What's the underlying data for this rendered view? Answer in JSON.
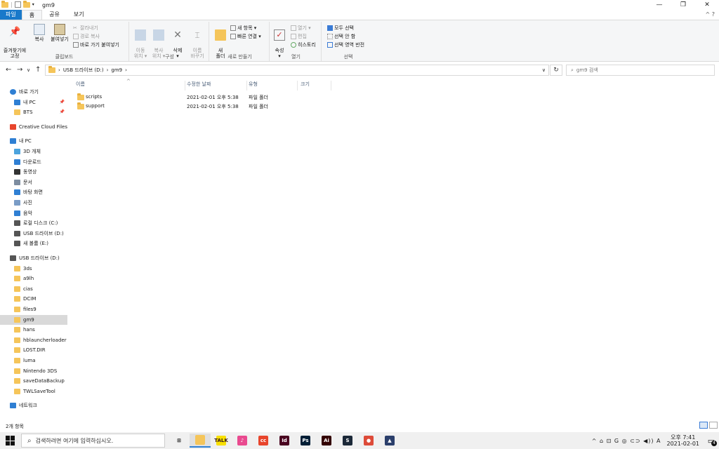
{
  "window": {
    "title": "gm9",
    "controls": {
      "minimize": "—",
      "maximize": "❐",
      "close": "✕"
    }
  },
  "ribbon_tabs": [
    "파일",
    "홈",
    "공유",
    "보기"
  ],
  "ribbon_help": "^ ?",
  "ribbon": {
    "clipboard": {
      "name": "클립보드",
      "pin": "즐겨찾기에\n고정",
      "copy": "복사",
      "paste": "붙여넣기",
      "cut": "잘라내기",
      "copy_path": "경로 복사",
      "paste_shortcut": "바로 가기 붙여넣기"
    },
    "organize": {
      "name": "구성",
      "move_to": "이동\n위치 ▾",
      "copy_to": "복사\n위치 ▾",
      "delete": "삭제\n▾",
      "rename": "이름\n바꾸기"
    },
    "new": {
      "name": "새로 만들기",
      "new_folder": "새\n폴더",
      "new_item": "새 항목 ▾",
      "easy_access": "빠른 연결 ▾"
    },
    "open": {
      "name": "열기",
      "properties": "속성\n▾",
      "open": "열기 ▾",
      "edit": "편집",
      "history": "히스토리"
    },
    "select": {
      "name": "선택",
      "select_all": "모두 선택",
      "select_none": "선택 안 함",
      "invert": "선택 영역 반전"
    }
  },
  "address": {
    "crumbs": [
      "USB 드라이브 (D:)",
      "gm9"
    ],
    "search_placeholder": "gm9 검색"
  },
  "sidebar": {
    "items": [
      {
        "label": "바로 가기",
        "icon": "star-icon",
        "indent": 0,
        "pinned": false
      },
      {
        "label": "내 PC",
        "icon": "pc-icon",
        "indent": 1,
        "pinned": true
      },
      {
        "label": "BTS",
        "icon": "folder-icon",
        "indent": 1,
        "pinned": true
      },
      {
        "label": "Creative Cloud Files",
        "icon": "creative-cloud-icon",
        "indent": 0,
        "pinned": false
      },
      {
        "label": "내 PC",
        "icon": "pc-icon",
        "indent": 0,
        "pinned": false
      },
      {
        "label": "3D 개체",
        "icon": "cube-icon",
        "indent": 1,
        "pinned": false
      },
      {
        "label": "다운로드",
        "icon": "download-icon",
        "indent": 1,
        "pinned": false
      },
      {
        "label": "동영상",
        "icon": "video-icon",
        "indent": 1,
        "pinned": false
      },
      {
        "label": "문서",
        "icon": "document-icon",
        "indent": 1,
        "pinned": false
      },
      {
        "label": "바탕 화면",
        "icon": "desktop-icon",
        "indent": 1,
        "pinned": false
      },
      {
        "label": "사진",
        "icon": "pictures-icon",
        "indent": 1,
        "pinned": false
      },
      {
        "label": "음악",
        "icon": "music-icon",
        "indent": 1,
        "pinned": false
      },
      {
        "label": "로컬 디스크 (C:)",
        "icon": "disk-icon",
        "indent": 1,
        "pinned": false
      },
      {
        "label": "USB 드라이브 (D:)",
        "icon": "usb-drive-icon",
        "indent": 1,
        "pinned": false
      },
      {
        "label": "새 볼륨 (E:)",
        "icon": "disk-icon",
        "indent": 1,
        "pinned": false
      },
      {
        "label": "USB 드라이브 (D:)",
        "icon": "usb-drive-icon",
        "indent": 0,
        "pinned": false
      },
      {
        "label": "3ds",
        "icon": "folder-icon",
        "indent": 1,
        "pinned": false
      },
      {
        "label": "a9lh",
        "icon": "folder-icon",
        "indent": 1,
        "pinned": false
      },
      {
        "label": "cias",
        "icon": "folder-icon",
        "indent": 1,
        "pinned": false
      },
      {
        "label": "DCIM",
        "icon": "folder-icon",
        "indent": 1,
        "pinned": false
      },
      {
        "label": "files9",
        "icon": "folder-icon",
        "indent": 1,
        "pinned": false
      },
      {
        "label": "gm9",
        "icon": "folder-icon",
        "indent": 1,
        "pinned": false,
        "selected": true
      },
      {
        "label": "hans",
        "icon": "folder-icon",
        "indent": 1,
        "pinned": false
      },
      {
        "label": "hblauncherloader",
        "icon": "folder-icon",
        "indent": 1,
        "pinned": false
      },
      {
        "label": "LOST.DIR",
        "icon": "folder-icon",
        "indent": 1,
        "pinned": false
      },
      {
        "label": "luma",
        "icon": "folder-icon",
        "indent": 1,
        "pinned": false
      },
      {
        "label": "Nintendo 3DS",
        "icon": "folder-icon",
        "indent": 1,
        "pinned": false
      },
      {
        "label": "saveDataBackup",
        "icon": "folder-icon",
        "indent": 1,
        "pinned": false
      },
      {
        "label": "TWLSaveTool",
        "icon": "folder-icon",
        "indent": 1,
        "pinned": false
      },
      {
        "label": "네트워크",
        "icon": "network-icon",
        "indent": 0,
        "pinned": false
      }
    ]
  },
  "columns": [
    "이름",
    "수정한 날짜",
    "유형",
    "크기"
  ],
  "files": [
    {
      "name": "scripts",
      "modified": "2021-02-01 오후 5:38",
      "type": "파일 폴더",
      "size": ""
    },
    {
      "name": "support",
      "modified": "2021-02-01 오후 5:38",
      "type": "파일 폴더",
      "size": ""
    }
  ],
  "status": {
    "count": "2개 항목"
  },
  "taskbar": {
    "search_placeholder": "검색하려면 여기에 입력하십시오.",
    "apps": [
      {
        "name": "task-view",
        "glyph": "⊞",
        "color": "#f0f0f0"
      },
      {
        "name": "file-explorer",
        "glyph": "",
        "color": "#f5c55a",
        "active": true
      },
      {
        "name": "kakaotalk",
        "glyph": "TALK",
        "color": "#f9e000"
      },
      {
        "name": "itunes",
        "glyph": "♪",
        "color": "#e94a8f"
      },
      {
        "name": "creative-cloud",
        "glyph": "cc",
        "color": "#e8452c"
      },
      {
        "name": "indesign",
        "glyph": "Id",
        "color": "#49021f"
      },
      {
        "name": "photoshop",
        "glyph": "Ps",
        "color": "#001e36"
      },
      {
        "name": "illustrator",
        "glyph": "Ai",
        "color": "#330000"
      },
      {
        "name": "steam",
        "glyph": "S",
        "color": "#1b2838"
      },
      {
        "name": "chrome",
        "glyph": "●",
        "color": "#dd4b39"
      },
      {
        "name": "game-app",
        "glyph": "▲",
        "color": "#2b3f6b"
      }
    ],
    "tray": {
      "icons": "^ ⌂ ⊡ G ◎ ⊂⊃ ◀)) A",
      "time": "오후 7:41",
      "date": "2021-02-01",
      "notifications": "4"
    }
  }
}
